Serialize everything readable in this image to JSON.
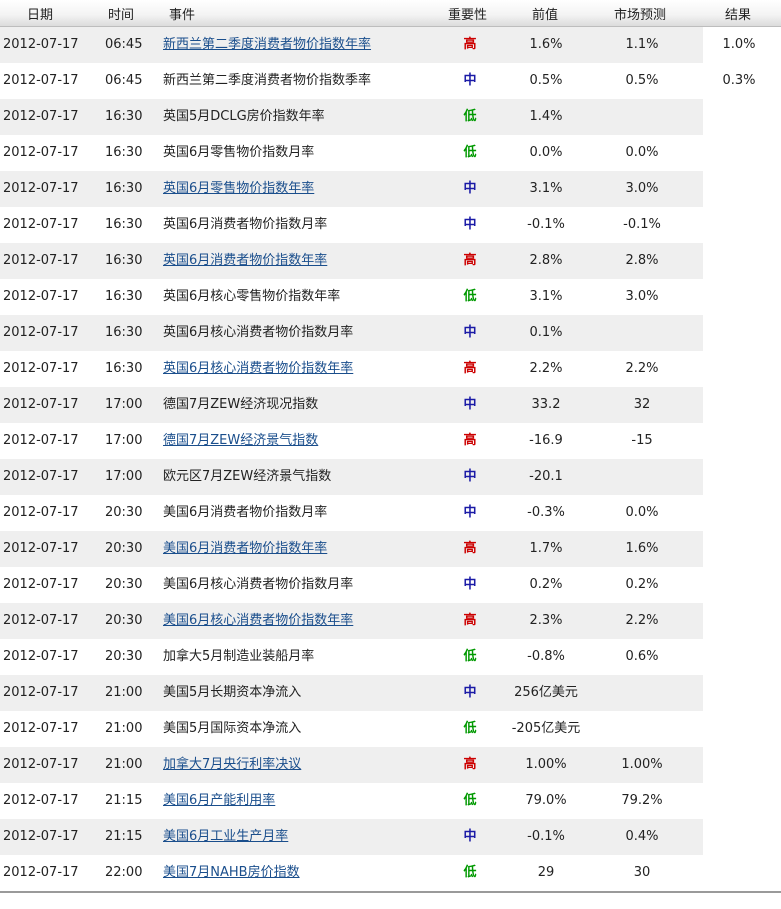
{
  "columns": {
    "date": "日期",
    "time": "时间",
    "event": "事件",
    "importance": "重要性",
    "previous": "前值",
    "forecast": "市场预测",
    "result": "结果"
  },
  "importance_colors": {
    "高": "#cc0000",
    "中": "#1a1aa6",
    "低": "#009900"
  },
  "rows": [
    {
      "date": "2012-07-17",
      "time": "06:45",
      "event": "新西兰第二季度消费者物价指数年率",
      "link": true,
      "importance": "高",
      "previous": "1.6%",
      "forecast": "1.1%",
      "result": "1.0%"
    },
    {
      "date": "2012-07-17",
      "time": "06:45",
      "event": "新西兰第二季度消费者物价指数季率",
      "link": false,
      "importance": "中",
      "previous": "0.5%",
      "forecast": "0.5%",
      "result": "0.3%"
    },
    {
      "date": "2012-07-17",
      "time": "16:30",
      "event": "英国5月DCLG房价指数年率",
      "link": false,
      "importance": "低",
      "previous": "1.4%",
      "forecast": "",
      "result": ""
    },
    {
      "date": "2012-07-17",
      "time": "16:30",
      "event": "英国6月零售物价指数月率",
      "link": false,
      "importance": "低",
      "previous": "0.0%",
      "forecast": "0.0%",
      "result": ""
    },
    {
      "date": "2012-07-17",
      "time": "16:30",
      "event": "英国6月零售物价指数年率",
      "link": true,
      "importance": "中",
      "previous": "3.1%",
      "forecast": "3.0%",
      "result": ""
    },
    {
      "date": "2012-07-17",
      "time": "16:30",
      "event": "英国6月消费者物价指数月率",
      "link": false,
      "importance": "中",
      "previous": "-0.1%",
      "forecast": "-0.1%",
      "result": ""
    },
    {
      "date": "2012-07-17",
      "time": "16:30",
      "event": "英国6月消费者物价指数年率",
      "link": true,
      "importance": "高",
      "previous": "2.8%",
      "forecast": "2.8%",
      "result": ""
    },
    {
      "date": "2012-07-17",
      "time": "16:30",
      "event": "英国6月核心零售物价指数年率",
      "link": false,
      "importance": "低",
      "previous": "3.1%",
      "forecast": "3.0%",
      "result": ""
    },
    {
      "date": "2012-07-17",
      "time": "16:30",
      "event": "英国6月核心消费者物价指数月率",
      "link": false,
      "importance": "中",
      "previous": "0.1%",
      "forecast": "",
      "result": ""
    },
    {
      "date": "2012-07-17",
      "time": "16:30",
      "event": "英国6月核心消费者物价指数年率",
      "link": true,
      "importance": "高",
      "previous": "2.2%",
      "forecast": "2.2%",
      "result": ""
    },
    {
      "date": "2012-07-17",
      "time": "17:00",
      "event": "德国7月ZEW经济现况指数",
      "link": false,
      "importance": "中",
      "previous": "33.2",
      "forecast": "32",
      "result": ""
    },
    {
      "date": "2012-07-17",
      "time": "17:00",
      "event": "德国7月ZEW经济景气指数",
      "link": true,
      "importance": "高",
      "previous": "-16.9",
      "forecast": "-15",
      "result": ""
    },
    {
      "date": "2012-07-17",
      "time": "17:00",
      "event": "欧元区7月ZEW经济景气指数",
      "link": false,
      "importance": "中",
      "previous": "-20.1",
      "forecast": "",
      "result": ""
    },
    {
      "date": "2012-07-17",
      "time": "20:30",
      "event": "美国6月消费者物价指数月率",
      "link": false,
      "importance": "中",
      "previous": "-0.3%",
      "forecast": "0.0%",
      "result": ""
    },
    {
      "date": "2012-07-17",
      "time": "20:30",
      "event": "美国6月消费者物价指数年率",
      "link": true,
      "importance": "高",
      "previous": "1.7%",
      "forecast": "1.6%",
      "result": ""
    },
    {
      "date": "2012-07-17",
      "time": "20:30",
      "event": "美国6月核心消费者物价指数月率",
      "link": false,
      "importance": "中",
      "previous": "0.2%",
      "forecast": "0.2%",
      "result": ""
    },
    {
      "date": "2012-07-17",
      "time": "20:30",
      "event": "美国6月核心消费者物价指数年率",
      "link": true,
      "importance": "高",
      "previous": "2.3%",
      "forecast": "2.2%",
      "result": ""
    },
    {
      "date": "2012-07-17",
      "time": "20:30",
      "event": "加拿大5月制造业装船月率",
      "link": false,
      "importance": "低",
      "previous": "-0.8%",
      "forecast": "0.6%",
      "result": ""
    },
    {
      "date": "2012-07-17",
      "time": "21:00",
      "event": "美国5月长期资本净流入",
      "link": false,
      "importance": "中",
      "previous": "256亿美元",
      "forecast": "",
      "result": ""
    },
    {
      "date": "2012-07-17",
      "time": "21:00",
      "event": "美国5月国际资本净流入",
      "link": false,
      "importance": "低",
      "previous": "-205亿美元",
      "forecast": "",
      "result": ""
    },
    {
      "date": "2012-07-17",
      "time": "21:00",
      "event": "加拿大7月央行利率决议",
      "link": true,
      "importance": "高",
      "previous": "1.00%",
      "forecast": "1.00%",
      "result": ""
    },
    {
      "date": "2012-07-17",
      "time": "21:15",
      "event": "美国6月产能利用率",
      "link": true,
      "importance": "低",
      "previous": "79.0%",
      "forecast": "79.2%",
      "result": ""
    },
    {
      "date": "2012-07-17",
      "time": "21:15",
      "event": "美国6月工业生产月率",
      "link": true,
      "importance": "中",
      "previous": "-0.1%",
      "forecast": "0.4%",
      "result": ""
    },
    {
      "date": "2012-07-17",
      "time": "22:00",
      "event": "美国7月NAHB房价指数",
      "link": true,
      "importance": "低",
      "previous": "29",
      "forecast": "30",
      "result": ""
    }
  ]
}
